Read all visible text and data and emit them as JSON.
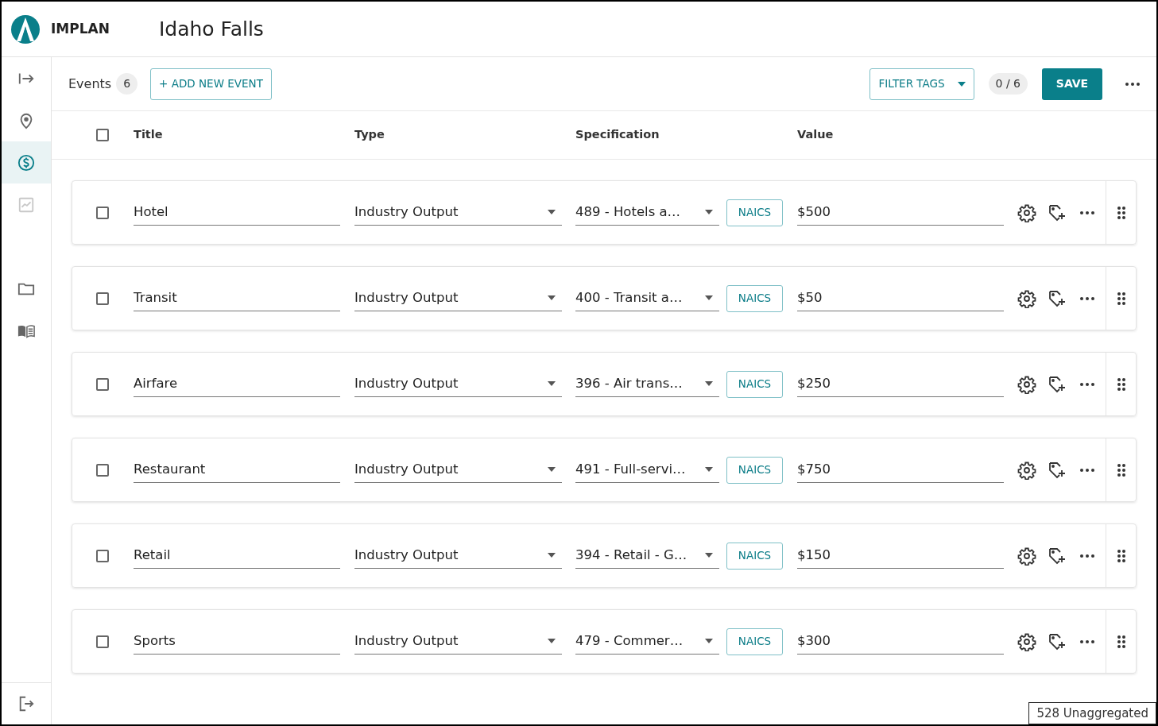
{
  "app": {
    "logo_text": "IMPLAN",
    "title": "Idaho Falls"
  },
  "sidebar": {
    "items": [
      {
        "kind": "expand",
        "selected": false,
        "disabled": false
      },
      {
        "kind": "pin",
        "selected": false,
        "disabled": false
      },
      {
        "kind": "dollar",
        "selected": true,
        "disabled": false
      },
      {
        "kind": "chart",
        "selected": false,
        "disabled": true
      }
    ],
    "items_2": [
      {
        "kind": "folder",
        "selected": false,
        "disabled": false
      },
      {
        "kind": "book",
        "selected": false,
        "disabled": false
      }
    ],
    "bottom": {
      "kind": "logout"
    }
  },
  "toolbar": {
    "label": "Events",
    "count": "6",
    "add_button": "+ ADD NEW EVENT",
    "filter_button": "FILTER TAGS",
    "selection_count": "0 / 6",
    "save_button": "SAVE"
  },
  "table": {
    "columns": [
      "Title",
      "Type",
      "Specification",
      "Value"
    ],
    "header_checked": false,
    "rows": [
      {
        "checked": false,
        "title": "Hotel",
        "type": "Industry Output",
        "specification": "489 - Hotels a…",
        "tag": "NAICS",
        "value": "$500"
      },
      {
        "checked": false,
        "title": "Transit",
        "type": "Industry Output",
        "specification": "400 - Transit a…",
        "tag": "NAICS",
        "value": "$50"
      },
      {
        "checked": false,
        "title": "Airfare",
        "type": "Industry Output",
        "specification": "396 - Air trans…",
        "tag": "NAICS",
        "value": "$250"
      },
      {
        "checked": false,
        "title": "Restaurant",
        "type": "Industry Output",
        "specification": "491 - Full-servi…",
        "tag": "NAICS",
        "value": "$750"
      },
      {
        "checked": false,
        "title": "Retail",
        "type": "Industry Output",
        "specification": "394 - Retail - G…",
        "tag": "NAICS",
        "value": "$150"
      },
      {
        "checked": false,
        "title": "Sports",
        "type": "Industry Output",
        "specification": "479 - Commer…",
        "tag": "NAICS",
        "value": "$300"
      }
    ]
  },
  "status": {
    "text": "528 Unaggregated"
  }
}
